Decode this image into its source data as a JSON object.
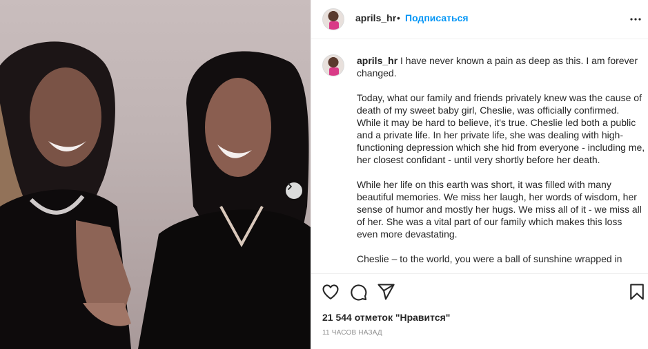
{
  "post": {
    "username": "aprils_hr",
    "separator": "•",
    "follow_label": "Подписаться",
    "caption": "I have never known a pain as deep as this. I am forever changed.\n\nToday, what our family and friends privately knew was the cause of death of my sweet baby girl, Cheslie, was officially confirmed. While it may be hard to believe, it's true. Cheslie led both a public and a private life. In her private life, she was dealing with high-functioning depression which she hid from everyone - including me, her closest confidant - until very shortly before her death.\n\nWhile her life on this earth was short, it was filled with many beautiful memories. We miss her laugh, her words of wisdom, her sense of humor and mostly her hugs. We miss all of it - we miss all of her. She was a vital part of our family which makes this loss even more devastating.\n\nCheslie – to the world, you were a ball of sunshine wrapped in",
    "likes_text": "21 544 отметок \"Нравится\"",
    "timestamp": "11 ЧАСОВ НАЗАД"
  },
  "icons": {
    "more": "more-horizontal-icon",
    "carousel_next": "chevron-right-icon",
    "like": "heart-icon",
    "comment": "comment-icon",
    "share": "paper-plane-icon",
    "save": "bookmark-icon"
  },
  "colors": {
    "accent": "#0095f6",
    "text": "#262626",
    "muted": "#8e8e8e",
    "divider": "#efefef"
  }
}
